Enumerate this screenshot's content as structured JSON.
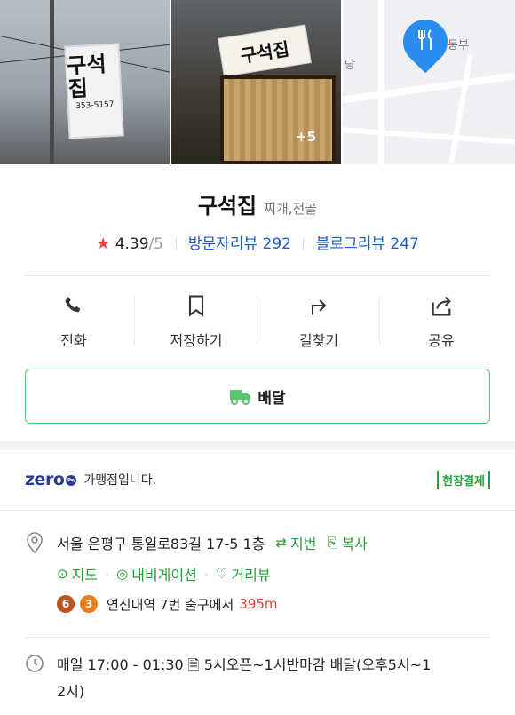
{
  "gallery": {
    "photo1_sign_text": "구석집",
    "photo1_phone": "353-5157",
    "photo2_sign_text": "구석집",
    "more_photos": "+5",
    "map_label_1": "당",
    "map_label_2": "동부"
  },
  "place": {
    "name": "구석집",
    "category": "찌개,전골",
    "rating": "4.39",
    "rating_max": "/5",
    "visitor_review_label": "방문자리뷰",
    "visitor_review_count": "292",
    "blog_review_label": "블로그리뷰",
    "blog_review_count": "247"
  },
  "actions": [
    {
      "label": "전화",
      "icon": "phone-icon"
    },
    {
      "label": "저장하기",
      "icon": "bookmark-icon"
    },
    {
      "label": "길찾기",
      "icon": "directions-icon"
    },
    {
      "label": "공유",
      "icon": "share-icon"
    }
  ],
  "delivery": {
    "label": "배달",
    "icon": "delivery-truck-icon",
    "accent": "#58c66a"
  },
  "zeropay": {
    "logo": "zero",
    "logo_sub": "Pay",
    "text": "가맹점입니다.",
    "badge": "현장결제",
    "brand_color": "#2b3c98"
  },
  "info": {
    "address": "서울 은평구 통일로83길 17-5 1층",
    "jibun_label": "지번",
    "copy_label": "복사",
    "map_label": "지도",
    "navigation_label": "내비게이션",
    "street_view_label": "거리뷰",
    "subway_lines": [
      "6",
      "3"
    ],
    "subway_text": "연신내역 7번 출구에서",
    "subway_distance": "395m",
    "hours_line1": "매일 17:00 - 01:30",
    "hours_note": "5시오픈~1시반마감 배달(오후5시~1",
    "hours_note_cont": "2시)"
  },
  "colors": {
    "accent_green": "#25a03a",
    "link_blue": "#1a5bd8",
    "star_red": "#e8433c",
    "line6": "#b8561e",
    "line3": "#ef7c1c"
  }
}
